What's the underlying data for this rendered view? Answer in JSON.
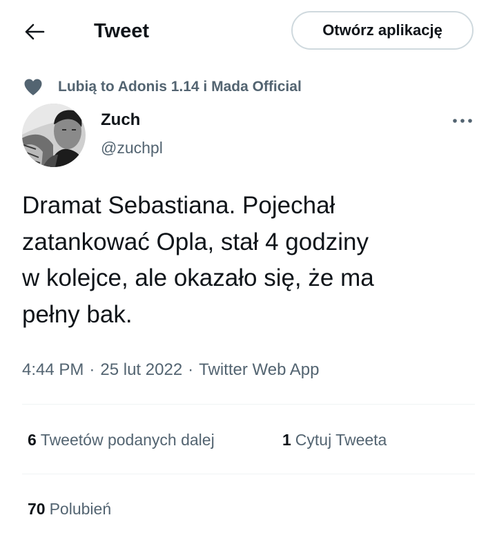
{
  "header": {
    "title": "Tweet",
    "open_app_label": "Otwórz aplikację",
    "back_icon": "arrow-left-icon"
  },
  "social_context": {
    "icon": "heart-icon",
    "text": "Lubią to Adonis 1.14 i Mada Official"
  },
  "tweet": {
    "author_name": "Zuch",
    "author_handle": "@zuchpl",
    "text": "Dramat Sebastiana. Pojechał\nzatankować Opla, stał 4 godziny\nw kolejce, ale okazało się, że ma\npełny bak.",
    "time": "4:44 PM",
    "date": "25 lut 2022",
    "source": "Twitter Web App",
    "separator": "·"
  },
  "stats": {
    "retweets_count": "6",
    "retweets_label": "Tweetów podanych dalej",
    "quotes_count": "1",
    "quotes_label": "Cytuj Tweeta",
    "likes_count": "70",
    "likes_label": "Polubień"
  },
  "colors": {
    "text_primary": "#0f1419",
    "text_secondary": "#536471",
    "border": "#cfd9de",
    "divider": "#eff3f4"
  }
}
